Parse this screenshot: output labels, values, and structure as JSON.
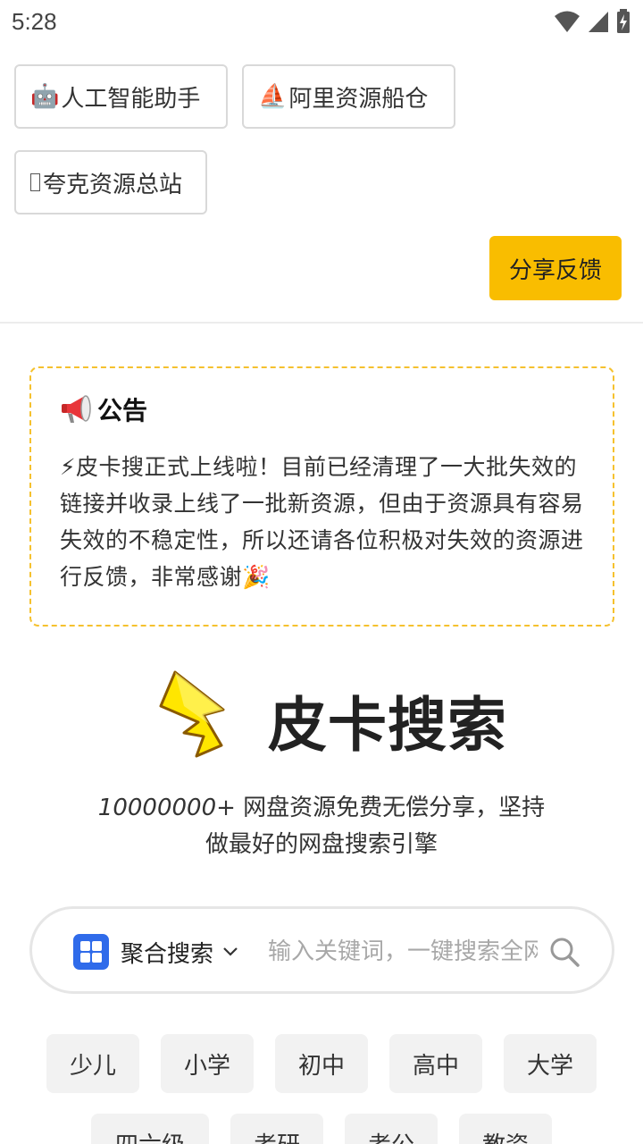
{
  "status_bar": {
    "time": "5:28"
  },
  "quick_links": [
    {
      "emoji": "🤖",
      "label": "人工智能助手"
    },
    {
      "emoji": "⛵",
      "label": "阿里资源船仓"
    },
    {
      "emoji": "",
      "label": "夸克资源总站"
    }
  ],
  "feedback_label": "分享反馈",
  "notice": {
    "title": "公告",
    "body": "⚡皮卡搜正式上线啦！目前已经清理了一大批失效的链接并收录上线了一批新资源，但由于资源具有容易失效的不稳定性，所以还请各位积极对失效的资源进行反馈，非常感谢🎉"
  },
  "brand": {
    "name": "皮卡搜索"
  },
  "tagline": {
    "number": "10000000+",
    "line1_rest": " 网盘资源免费无偿分享，坚持",
    "line2": "做最好的网盘搜索引擎"
  },
  "search": {
    "type_label": "聚合搜索",
    "placeholder": "输入关键词，一键搜索全网资源"
  },
  "categories_row1": [
    "少儿",
    "小学",
    "初中",
    "高中",
    "大学"
  ],
  "categories_row2": [
    "四六级",
    "考研",
    "考公",
    "教资"
  ],
  "colors": {
    "accent_yellow": "#f9bd00",
    "notice_border": "#f5c12e",
    "search_icon_blue": "#2f6bea"
  }
}
